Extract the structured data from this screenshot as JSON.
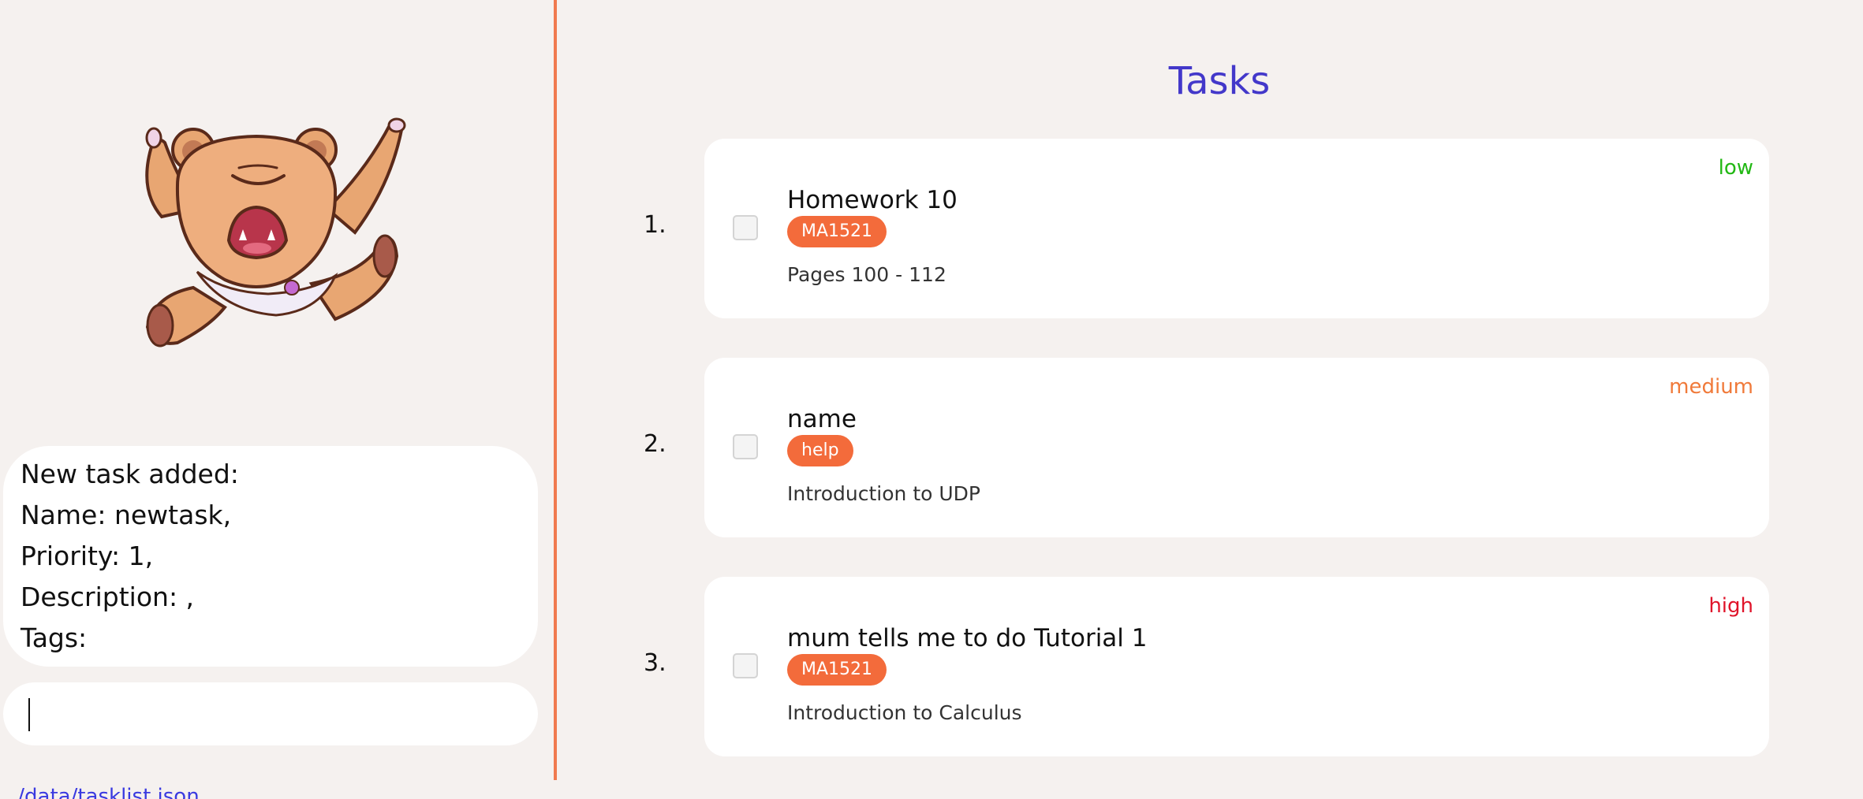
{
  "result_display": {
    "lines": [
      "New task added:",
      "Name: newtask,",
      "Priority: 1,",
      "Description: ,",
      "Tags:"
    ]
  },
  "command_box": {
    "value": "",
    "placeholder": ""
  },
  "status_bar": {
    "path": "./data/tasklist.json"
  },
  "task_list": {
    "title": "Tasks",
    "tasks": [
      {
        "index": "1.",
        "name": "Homework 10",
        "tag": "MA1521",
        "description": "Pages 100 - 112",
        "priority": "low",
        "priority_color": "#22b814",
        "done": false
      },
      {
        "index": "2.",
        "name": "name",
        "tag": "help",
        "description": "Introduction to UDP",
        "priority": "medium",
        "priority_color": "#f07a3a",
        "done": false
      },
      {
        "index": "3.",
        "name": "mum tells me to do Tutorial 1",
        "tag": "MA1521",
        "description": "Introduction to Calculus",
        "priority": "high",
        "priority_color": "#e0142a",
        "done": false
      }
    ]
  },
  "colors": {
    "background": "#f5f1ef",
    "accent": "#f07a4f",
    "tag": "#f36b3b",
    "title": "#4338ca"
  },
  "mascot": {
    "icon": "bear-mascot-icon"
  }
}
